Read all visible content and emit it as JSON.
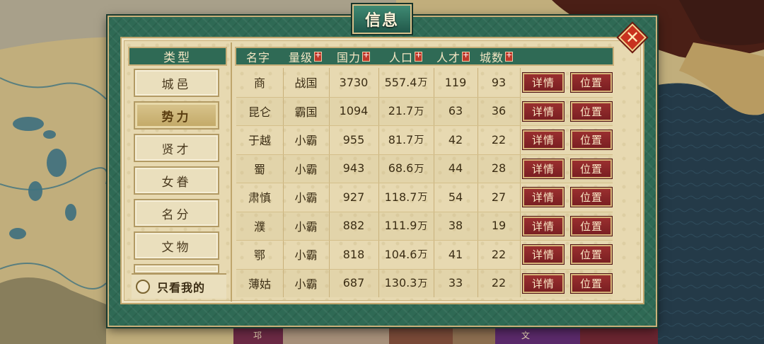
{
  "dialog": {
    "title": "信息",
    "close_label": "✕"
  },
  "categories": {
    "header": "类型",
    "items": [
      {
        "label": "城邑",
        "active": false
      },
      {
        "label": "势力",
        "active": true
      },
      {
        "label": "贤才",
        "active": false
      },
      {
        "label": "女眷",
        "active": false
      },
      {
        "label": "名分",
        "active": false
      },
      {
        "label": "文物",
        "active": false
      }
    ],
    "only_mine_label": "只看我的"
  },
  "table": {
    "columns": [
      "名字",
      "量级",
      "国力",
      "人口",
      "人才",
      "城数"
    ],
    "detail_label": "详情",
    "location_label": "位置",
    "unit_wan": "万",
    "rows": [
      {
        "name": "商",
        "rank": "战国",
        "power": "3730",
        "pop": "557.4",
        "talent": "119",
        "cities": "93"
      },
      {
        "name": "昆仑",
        "rank": "霸国",
        "power": "1094",
        "pop": "21.7",
        "talent": "63",
        "cities": "36"
      },
      {
        "name": "于越",
        "rank": "小霸",
        "power": "955",
        "pop": "81.7",
        "talent": "42",
        "cities": "22"
      },
      {
        "name": "蜀",
        "rank": "小霸",
        "power": "943",
        "pop": "68.6",
        "talent": "44",
        "cities": "28"
      },
      {
        "name": "肃慎",
        "rank": "小霸",
        "power": "927",
        "pop": "118.7",
        "talent": "54",
        "cities": "27"
      },
      {
        "name": "濮",
        "rank": "小霸",
        "power": "882",
        "pop": "111.9",
        "talent": "38",
        "cities": "19"
      },
      {
        "name": "鄂",
        "rank": "小霸",
        "power": "818",
        "pop": "104.6",
        "talent": "41",
        "cities": "22"
      },
      {
        "name": "薄姑",
        "rank": "小霸",
        "power": "687",
        "pop": "130.3",
        "talent": "33",
        "cities": "22"
      }
    ]
  },
  "map_labels": [
    "邛",
    "文"
  ]
}
